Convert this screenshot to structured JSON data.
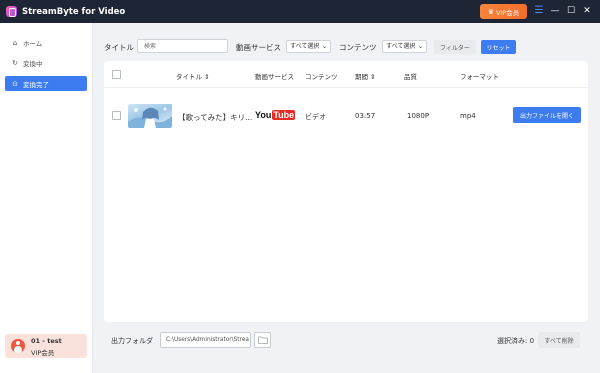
{
  "app": {
    "title": "StreamByte for Video",
    "vip_button": "VIP会员",
    "icons": {
      "logo": "app-logo-icon",
      "crown": "crown-icon",
      "menu": "hamburger-menu-icon",
      "minimize": "minimize-icon",
      "maximize": "maximize-icon",
      "close": "close-icon"
    }
  },
  "sidebar": {
    "items": [
      {
        "label": "ホーム",
        "icon": "home-icon",
        "active": false
      },
      {
        "label": "変換中",
        "icon": "refresh-icon",
        "active": false
      },
      {
        "label": "変換完了",
        "icon": "check-circle-icon",
        "active": true
      }
    ],
    "user": {
      "name": "01 - test",
      "badge": "VIP会员",
      "avatar_color": "#f0553c"
    }
  },
  "filters": {
    "title_label": "タイトル",
    "search_placeholder": "検索",
    "service_label": "動画サービス",
    "service_select": "すべて選択",
    "content_label": "コンテンツ",
    "content_select": "すべて選択",
    "filter_button": "フィルター",
    "reset_button": "リセット"
  },
  "table": {
    "columns": [
      "タイトル",
      "動画サービス",
      "コンテンツ",
      "期間",
      "品質",
      "フォーマット"
    ],
    "rows": [
      {
        "title": "【歌ってみた】キリ...",
        "service": "YouTube",
        "service_logo": [
          "You",
          "Tube"
        ],
        "content": "ビデオ",
        "duration": "03:57",
        "quality": "1080P",
        "format": "mp4",
        "action": "出力ファイルを開く"
      }
    ]
  },
  "footer": {
    "output_label": "出力フォルダ",
    "output_path": "C:\\Users\\Administrator\\Strea",
    "folder_icon": "folder-icon",
    "selected_count": "選択済み: 0",
    "clear_button": "すべて削除"
  },
  "colors": {
    "accent": "#3d7cf0",
    "titlebar": "#1e2636",
    "vip": "#f26d2a",
    "youtube_red": "#e52d27"
  }
}
